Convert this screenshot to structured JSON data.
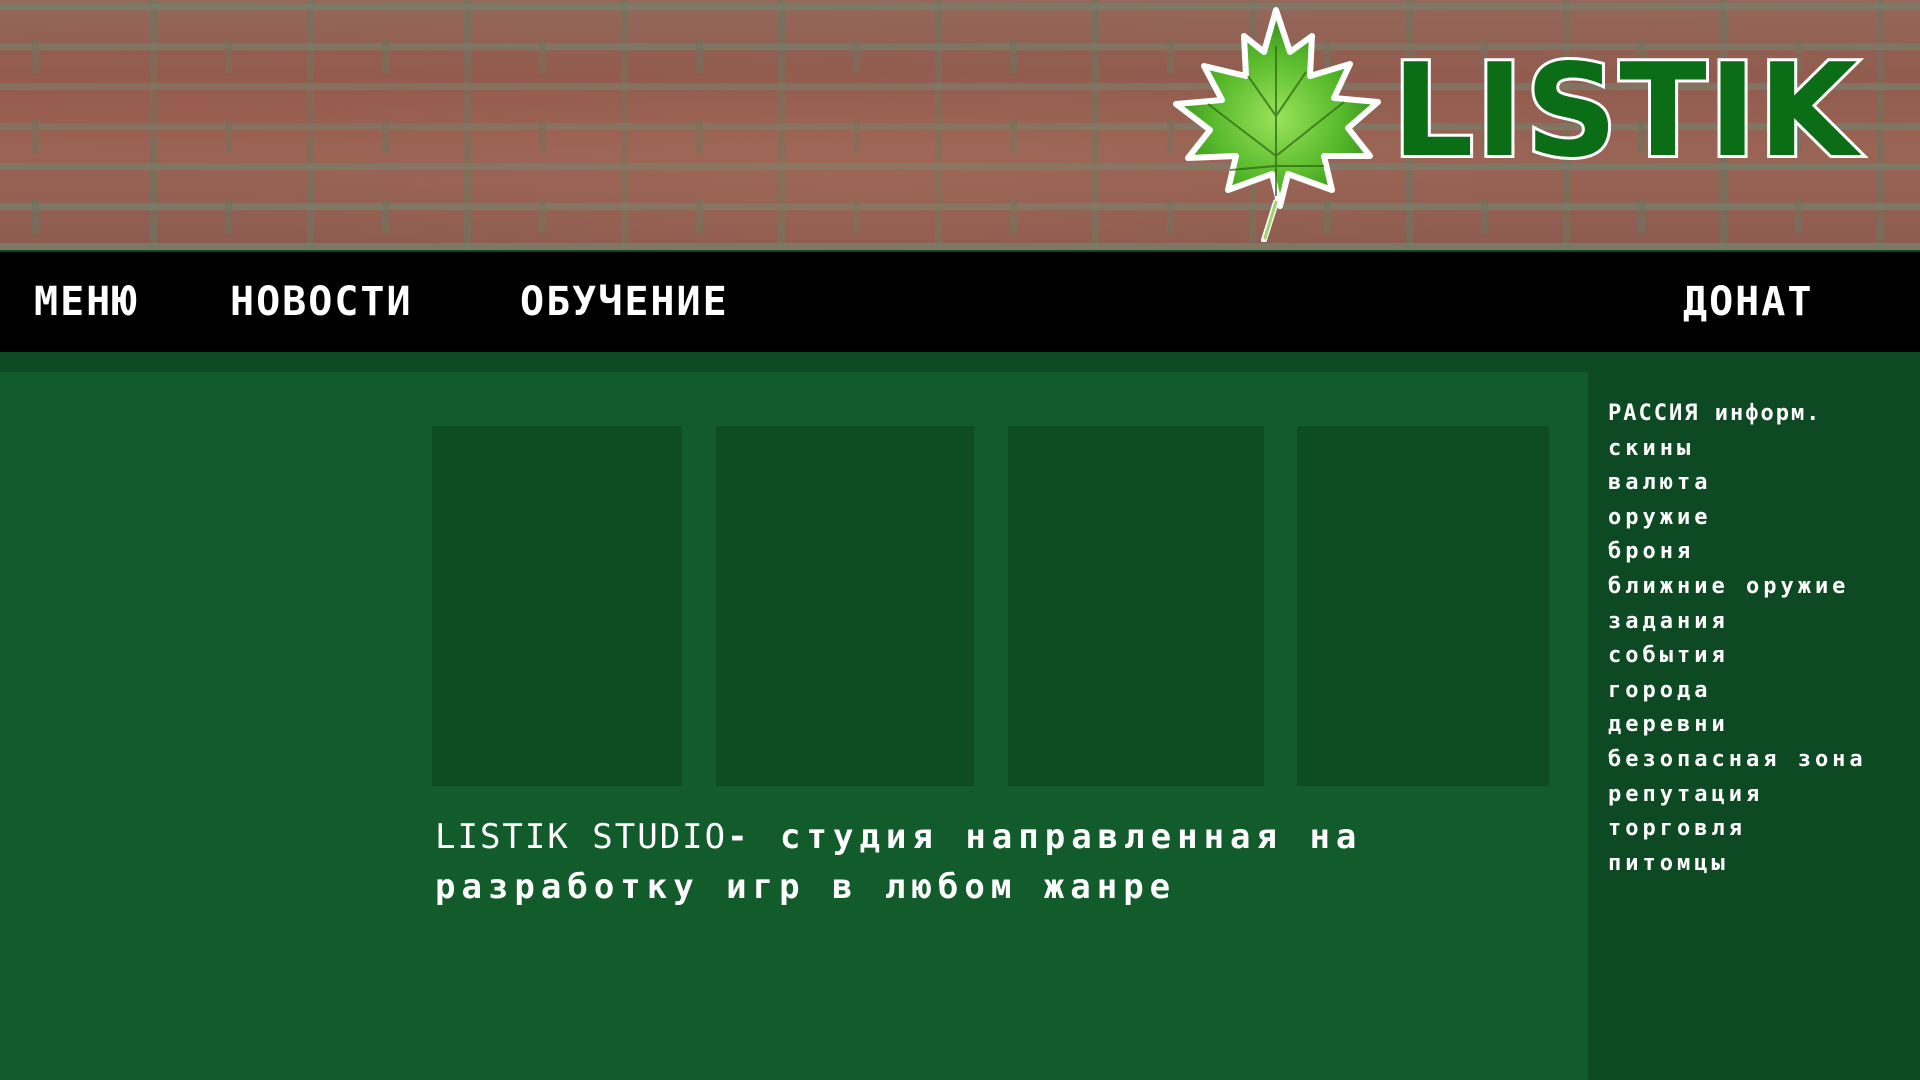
{
  "colors": {
    "brand_green": "#0b6e16",
    "nav_background": "#000000",
    "panel_green": "#125b2b",
    "card_green": "#0e4c21",
    "page_green": "#0d4a23",
    "text": "#ffffff"
  },
  "header": {
    "logo_icon": "maple-leaf-icon",
    "logo_text": "LISTIK"
  },
  "nav": {
    "menu": "МЕНЮ",
    "news": "НОВОСТИ",
    "tutorial": "ОБУЧЕНИЕ",
    "donate": "ДОНАТ"
  },
  "main": {
    "studio_name": "LISTIK STUDIO",
    "studio_tagline": "- студия направленная на разработку игр в любом жанре"
  },
  "sidebar": {
    "items": [
      "РАССИЯ информ.",
      "скины",
      "валюта",
      "оружие",
      "броня",
      "ближние оружие",
      "задания",
      "события",
      "города",
      "деревни",
      "безопасная зона",
      "репутация",
      "торговля",
      "питомцы"
    ]
  }
}
